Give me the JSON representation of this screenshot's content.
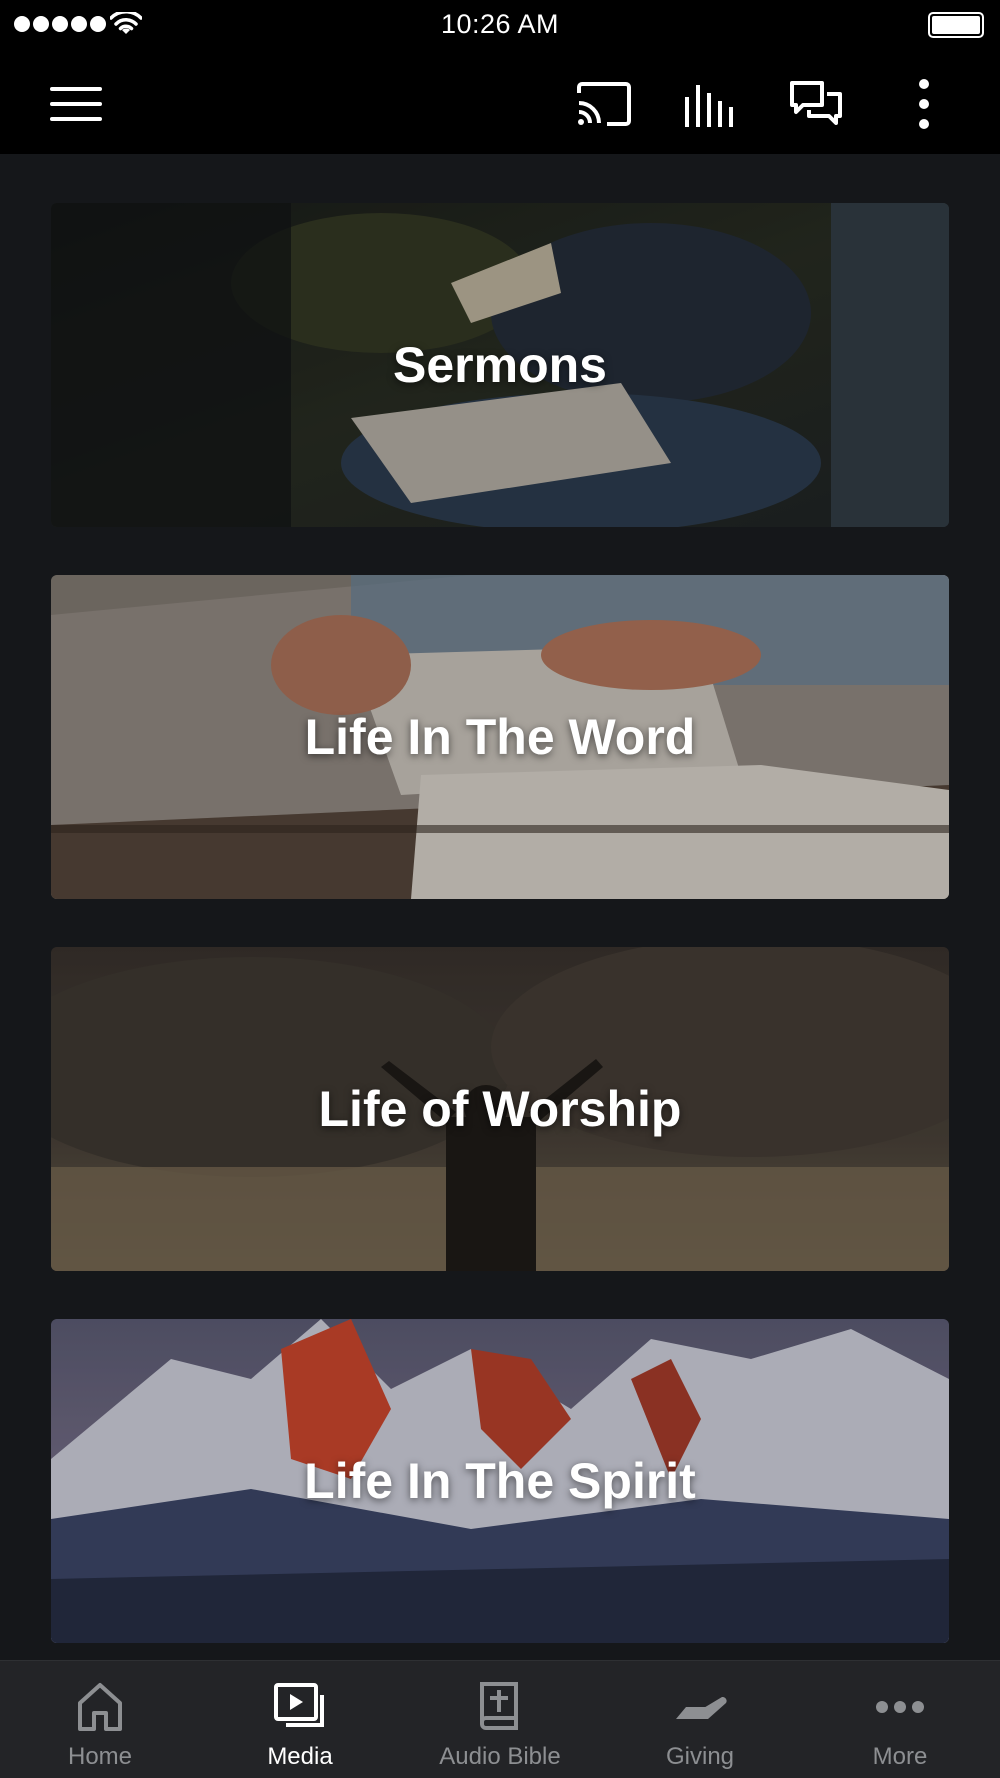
{
  "status_bar": {
    "time": "10:26 AM",
    "signal_icon": "signal-dots-icon",
    "wifi_icon": "wifi-icon",
    "battery_icon": "battery-icon"
  },
  "app_bar": {
    "menu_icon": "hamburger-menu-icon",
    "cast_icon": "cast-icon",
    "audio_icon": "audio-bars-icon",
    "chat_icon": "chat-icon",
    "more_icon": "more-vertical-icon"
  },
  "cards": [
    {
      "title": "Sermons"
    },
    {
      "title": "Life In The Word"
    },
    {
      "title": "Life of Worship"
    },
    {
      "title": "Life In The Spirit"
    }
  ],
  "tabs": [
    {
      "label": "Home",
      "icon": "home-icon",
      "active": false
    },
    {
      "label": "Media",
      "icon": "media-icon",
      "active": true
    },
    {
      "label": "Audio Bible",
      "icon": "bible-icon",
      "active": false
    },
    {
      "label": "Giving",
      "icon": "giving-icon",
      "active": false
    },
    {
      "label": "More",
      "icon": "more-horizontal-icon",
      "active": false
    }
  ],
  "colors": {
    "background": "#15171a",
    "bar": "#000000",
    "tab_bar": "#232427",
    "tab_inactive": "#8d8f92",
    "tab_active": "#ffffff"
  }
}
